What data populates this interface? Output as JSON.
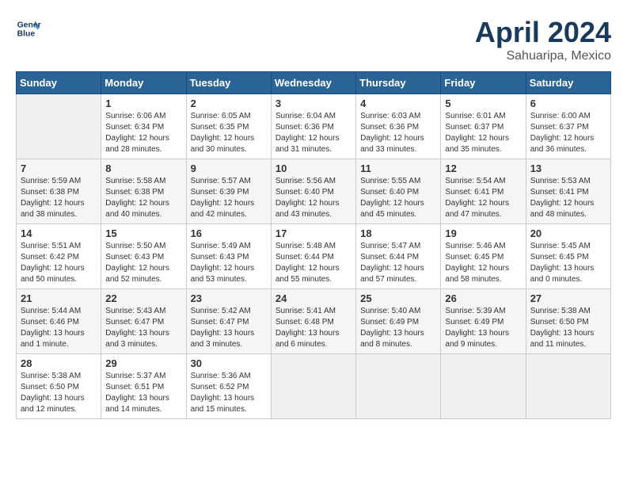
{
  "header": {
    "logo_line1": "General",
    "logo_line2": "Blue",
    "title": "April 2024",
    "subtitle": "Sahuaripa, Mexico"
  },
  "columns": [
    "Sunday",
    "Monday",
    "Tuesday",
    "Wednesday",
    "Thursday",
    "Friday",
    "Saturday"
  ],
  "weeks": [
    [
      {
        "day": "",
        "info": ""
      },
      {
        "day": "1",
        "info": "Sunrise: 6:06 AM\nSunset: 6:34 PM\nDaylight: 12 hours\nand 28 minutes."
      },
      {
        "day": "2",
        "info": "Sunrise: 6:05 AM\nSunset: 6:35 PM\nDaylight: 12 hours\nand 30 minutes."
      },
      {
        "day": "3",
        "info": "Sunrise: 6:04 AM\nSunset: 6:36 PM\nDaylight: 12 hours\nand 31 minutes."
      },
      {
        "day": "4",
        "info": "Sunrise: 6:03 AM\nSunset: 6:36 PM\nDaylight: 12 hours\nand 33 minutes."
      },
      {
        "day": "5",
        "info": "Sunrise: 6:01 AM\nSunset: 6:37 PM\nDaylight: 12 hours\nand 35 minutes."
      },
      {
        "day": "6",
        "info": "Sunrise: 6:00 AM\nSunset: 6:37 PM\nDaylight: 12 hours\nand 36 minutes."
      }
    ],
    [
      {
        "day": "7",
        "info": "Sunrise: 5:59 AM\nSunset: 6:38 PM\nDaylight: 12 hours\nand 38 minutes."
      },
      {
        "day": "8",
        "info": "Sunrise: 5:58 AM\nSunset: 6:38 PM\nDaylight: 12 hours\nand 40 minutes."
      },
      {
        "day": "9",
        "info": "Sunrise: 5:57 AM\nSunset: 6:39 PM\nDaylight: 12 hours\nand 42 minutes."
      },
      {
        "day": "10",
        "info": "Sunrise: 5:56 AM\nSunset: 6:40 PM\nDaylight: 12 hours\nand 43 minutes."
      },
      {
        "day": "11",
        "info": "Sunrise: 5:55 AM\nSunset: 6:40 PM\nDaylight: 12 hours\nand 45 minutes."
      },
      {
        "day": "12",
        "info": "Sunrise: 5:54 AM\nSunset: 6:41 PM\nDaylight: 12 hours\nand 47 minutes."
      },
      {
        "day": "13",
        "info": "Sunrise: 5:53 AM\nSunset: 6:41 PM\nDaylight: 12 hours\nand 48 minutes."
      }
    ],
    [
      {
        "day": "14",
        "info": "Sunrise: 5:51 AM\nSunset: 6:42 PM\nDaylight: 12 hours\nand 50 minutes."
      },
      {
        "day": "15",
        "info": "Sunrise: 5:50 AM\nSunset: 6:43 PM\nDaylight: 12 hours\nand 52 minutes."
      },
      {
        "day": "16",
        "info": "Sunrise: 5:49 AM\nSunset: 6:43 PM\nDaylight: 12 hours\nand 53 minutes."
      },
      {
        "day": "17",
        "info": "Sunrise: 5:48 AM\nSunset: 6:44 PM\nDaylight: 12 hours\nand 55 minutes."
      },
      {
        "day": "18",
        "info": "Sunrise: 5:47 AM\nSunset: 6:44 PM\nDaylight: 12 hours\nand 57 minutes."
      },
      {
        "day": "19",
        "info": "Sunrise: 5:46 AM\nSunset: 6:45 PM\nDaylight: 12 hours\nand 58 minutes."
      },
      {
        "day": "20",
        "info": "Sunrise: 5:45 AM\nSunset: 6:45 PM\nDaylight: 13 hours\nand 0 minutes."
      }
    ],
    [
      {
        "day": "21",
        "info": "Sunrise: 5:44 AM\nSunset: 6:46 PM\nDaylight: 13 hours\nand 1 minute."
      },
      {
        "day": "22",
        "info": "Sunrise: 5:43 AM\nSunset: 6:47 PM\nDaylight: 13 hours\nand 3 minutes."
      },
      {
        "day": "23",
        "info": "Sunrise: 5:42 AM\nSunset: 6:47 PM\nDaylight: 13 hours\nand 3 minutes."
      },
      {
        "day": "24",
        "info": "Sunrise: 5:41 AM\nSunset: 6:48 PM\nDaylight: 13 hours\nand 6 minutes."
      },
      {
        "day": "25",
        "info": "Sunrise: 5:40 AM\nSunset: 6:49 PM\nDaylight: 13 hours\nand 8 minutes."
      },
      {
        "day": "26",
        "info": "Sunrise: 5:39 AM\nSunset: 6:49 PM\nDaylight: 13 hours\nand 9 minutes."
      },
      {
        "day": "27",
        "info": "Sunrise: 5:38 AM\nSunset: 6:50 PM\nDaylight: 13 hours\nand 11 minutes."
      }
    ],
    [
      {
        "day": "28",
        "info": "Sunrise: 5:38 AM\nSunset: 6:50 PM\nDaylight: 13 hours\nand 12 minutes."
      },
      {
        "day": "29",
        "info": "Sunrise: 5:37 AM\nSunset: 6:51 PM\nDaylight: 13 hours\nand 14 minutes."
      },
      {
        "day": "30",
        "info": "Sunrise: 5:36 AM\nSunset: 6:52 PM\nDaylight: 13 hours\nand 15 minutes."
      },
      {
        "day": "",
        "info": ""
      },
      {
        "day": "",
        "info": ""
      },
      {
        "day": "",
        "info": ""
      },
      {
        "day": "",
        "info": ""
      }
    ]
  ]
}
